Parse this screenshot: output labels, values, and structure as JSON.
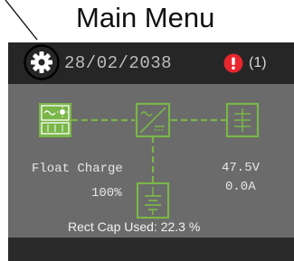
{
  "callout": {
    "title": "Main Menu"
  },
  "status_bar": {
    "date": "28/02/2038",
    "alarm_count": "(1)"
  },
  "icons": {
    "settings": "gear-icon",
    "alarm": "alarm-exclamation-icon",
    "ac_source": "ac-source-icon",
    "rectifier": "rectifier-icon",
    "dc_load": "dc-load-icon",
    "battery": "battery-icon"
  },
  "battery": {
    "state": "Float Charge",
    "level": "100%"
  },
  "output": {
    "voltage": "47.5V",
    "current": "0.0A"
  },
  "footer": {
    "rect_cap": "Rect Cap Used: 22.3 %"
  },
  "colors": {
    "accent_green": "#7ab648",
    "alarm_red": "#e8262d",
    "panel_bg": "#6b6b6b",
    "bar_bg": "#262626"
  }
}
